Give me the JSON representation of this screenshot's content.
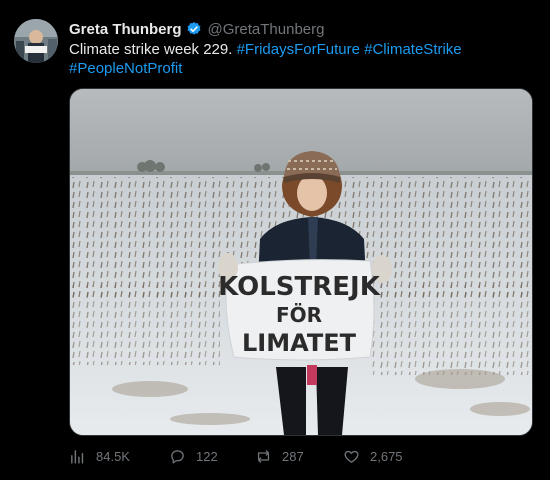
{
  "tweet": {
    "author_name": "Greta Thunberg",
    "handle": "@GretaThunberg",
    "text_plain": "Climate strike week 229. ",
    "hashtags": [
      "#FridaysForFuture",
      "#ClimateStrike",
      "#PeopleNotProfit"
    ]
  },
  "media": {
    "sign": {
      "line1": "KOLSTREJK",
      "line2": "FÖR",
      "line3": "LIMATET"
    }
  },
  "actions": {
    "views": "84.5K",
    "replies": "122",
    "retweets": "287",
    "likes": "2,675"
  },
  "icons": {
    "views": "views-icon",
    "reply": "reply-icon",
    "retweet": "retweet-icon",
    "like": "heart-icon",
    "verified": "verified-badge-icon"
  },
  "colors": {
    "accent": "#1d9bf0",
    "text": "#e7e9ea",
    "muted": "#71767b",
    "background": "#000000"
  }
}
